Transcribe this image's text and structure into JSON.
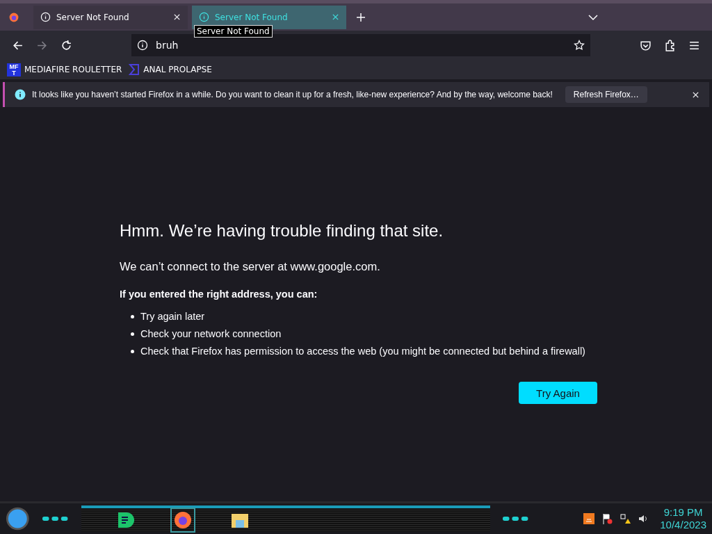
{
  "tabs": [
    {
      "title": "Server Not Found",
      "selected": false
    },
    {
      "title": "Server Not Found",
      "selected": true
    }
  ],
  "tooltip": "Server Not Found",
  "address_bar": {
    "value": "bruh"
  },
  "bookmarks": [
    {
      "label": "MEDIAFIRE ROULETTER",
      "icon_text": "MF T",
      "kind": "mf"
    },
    {
      "label": "ANAL PROLAPSE",
      "kind": "sigma"
    }
  ],
  "notification": {
    "message": "It looks like you haven’t started Firefox in a while. Do you want to clean it up for a fresh, like-new experience? And by the way, welcome back!",
    "button": "Refresh Firefox…"
  },
  "error_page": {
    "title": "Hmm. We’re having trouble finding that site.",
    "description": "We can’t connect to the server at www.google.com.",
    "subheading": "If you entered the right address, you can:",
    "suggestions": [
      "Try again later",
      "Check your network connection",
      "Check that Firefox has permission to access the web (you might be connected but behind a firewall)"
    ],
    "button": "Try Again"
  },
  "taskbar": {
    "time": "9:19 PM",
    "date": "10/4/2023"
  }
}
